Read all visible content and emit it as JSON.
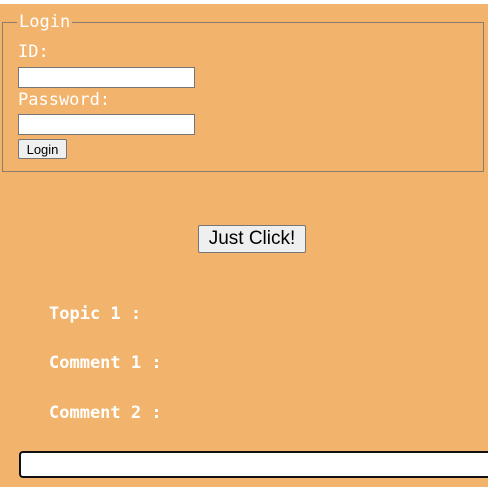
{
  "login": {
    "legend": "Login",
    "id_label": "ID:",
    "id_value": "",
    "password_label": "Password:",
    "password_value": "",
    "submit_label": "Login"
  },
  "main": {
    "click_button_label": "Just Click!",
    "topic_label": "Topic 1 :",
    "comment1_label": "Comment 1 :",
    "comment2_label": "Comment 2 :",
    "bottom_input_value": ""
  },
  "colors": {
    "background": "#f2b46c",
    "text": "#ffffff"
  }
}
